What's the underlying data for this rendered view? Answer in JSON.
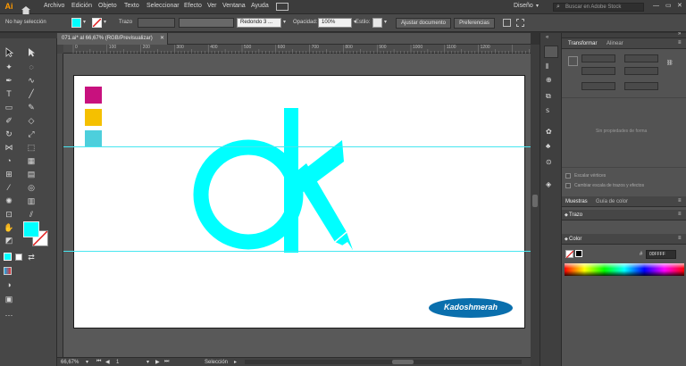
{
  "app": {
    "logo": "Ai"
  },
  "menu": [
    "Archivo",
    "Edición",
    "Objeto",
    "Texto",
    "Seleccionar",
    "Efecto",
    "Ver",
    "Ventana",
    "Ayuda"
  ],
  "workspace_menu": "Diseño",
  "search": {
    "placeholder": "Buscar en Adobe Stock"
  },
  "control": {
    "selection": "No hay selección",
    "stroke_label": "Trazo",
    "brush": "Redondo 3 ...",
    "opacity_label": "Opacidad:",
    "opacity_value": "100%",
    "style_label": "Estilo:",
    "adjust_button": "Ajustar documento",
    "prefs_button": "Preferencias"
  },
  "document_tab": "071.ai* al 66,67% (RGB/Previsualizar)",
  "ruler_ticks": [
    "0",
    "100",
    "200",
    "300",
    "400",
    "500",
    "600",
    "700",
    "800",
    "900",
    "1000",
    "1100",
    "1200"
  ],
  "artwork": {
    "swatches": [
      "#c8117e",
      "#f5c000",
      "#4dcfdc"
    ],
    "logo_color": "#00ffff",
    "badge_text": "Kadoshmerah",
    "badge_color": "#0a6fad"
  },
  "status": {
    "zoom": "66,67%",
    "artboard": "1",
    "tool": "Selección"
  },
  "panels": {
    "transform_tab": "Transformar",
    "align_tab": "Alinear",
    "no_props": "Sin propiedades de forma",
    "scale_corners": "Escalar vértices",
    "scale_strokes": "Cambiar escala de trazos y efectos",
    "swatches_tab": "Muestras",
    "brush_guide_tab": "Guía de color",
    "stroke_tab": "Trazo",
    "color_tab": "Color",
    "hex_value": "00FFFF"
  },
  "colors": {
    "fill": "#00ffff",
    "accent": "#47e6f0"
  }
}
